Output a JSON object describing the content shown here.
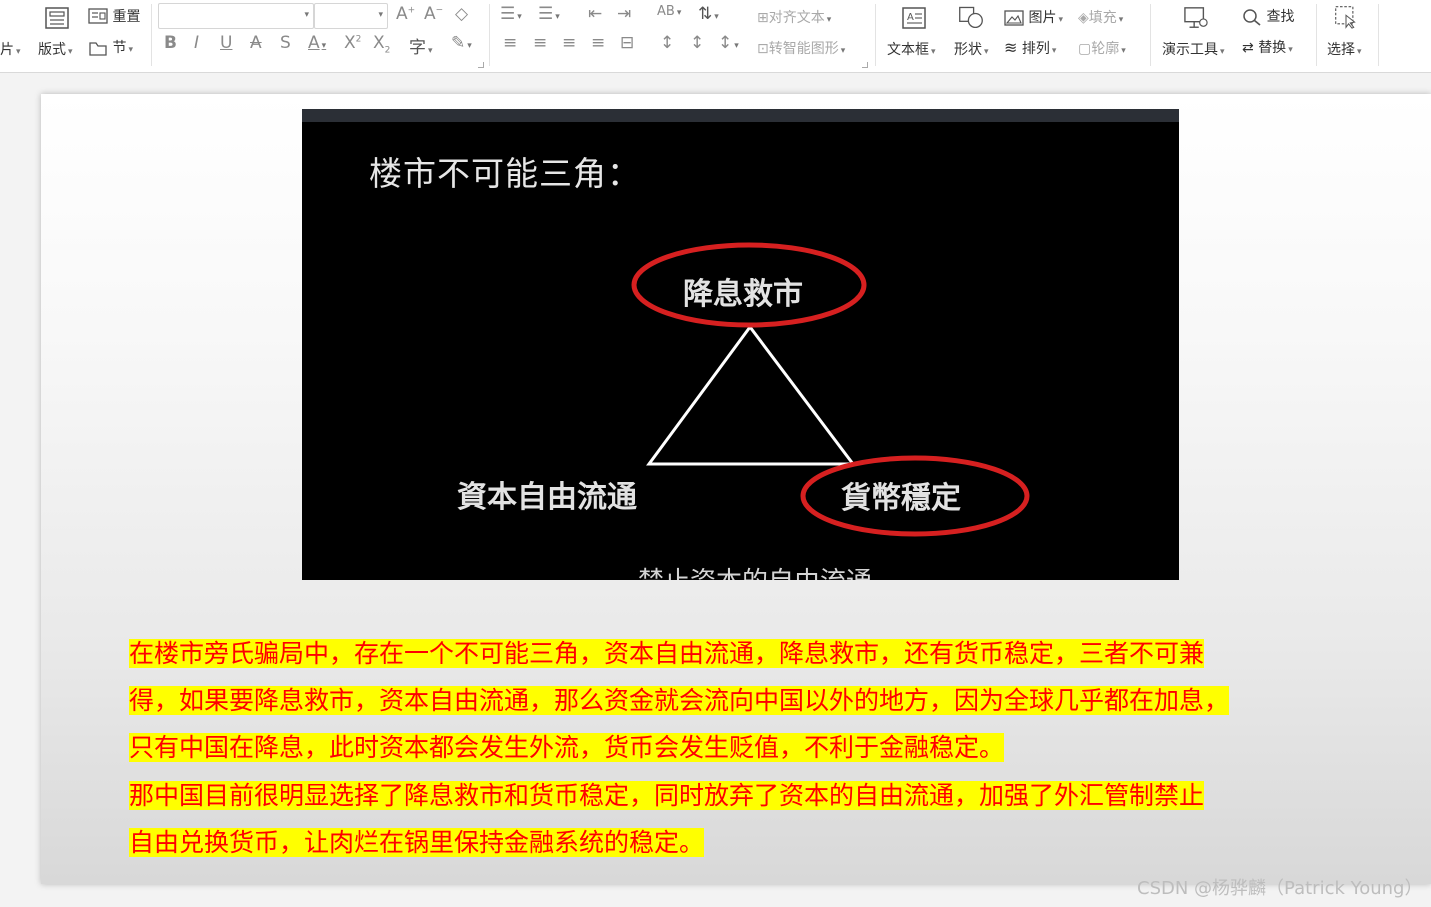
{
  "ribbon": {
    "image_label": "片",
    "layout_label": "版式",
    "reset_label": "重置",
    "section_label": "节",
    "align_text_label": "对齐文本",
    "smartart_label": "转智能图形",
    "textbox_label": "文本框",
    "shape_label": "形状",
    "picture_label": "图片",
    "arrange_label": "排列",
    "fill_label": "填充",
    "outline_label": "轮廓",
    "presenter_tools_label": "演示工具",
    "find_label": "查找",
    "replace_label": "替换",
    "select_label": "选择",
    "font_name": "",
    "font_size": ""
  },
  "slide": {
    "image": {
      "title": "楼市不可能三角：",
      "label_top": "降息救市",
      "label_left": "資本自由流通",
      "label_right": "貨幣穩定",
      "caption_cut": "禁止资本的自由流通"
    },
    "paragraph_lines": [
      "在楼市旁氏骗局中，存在一个不可能三角，资本自由流通，降息救市，还有货币稳定，三者不可兼",
      "得，如果要降息救市，资本自由流通，那么资金就会流向中国以外的地方，因为全球几乎都在加息，",
      "只有中国在降息，此时资本都会发生外流，货币会发生贬值，不利于金融稳定。",
      "那中国目前很明显选择了降息救市和货币稳定，同时放弃了资本的自由流通，加强了外汇管制禁止",
      "自由兑换货币，让肉烂在锅里保持金融系统的稳定。"
    ]
  },
  "watermark": "CSDN @杨骅麟（Patrick Young）",
  "colors": {
    "highlight": "#ffff00",
    "text_red": "#ff0000",
    "ellipse_red": "#d62020"
  }
}
